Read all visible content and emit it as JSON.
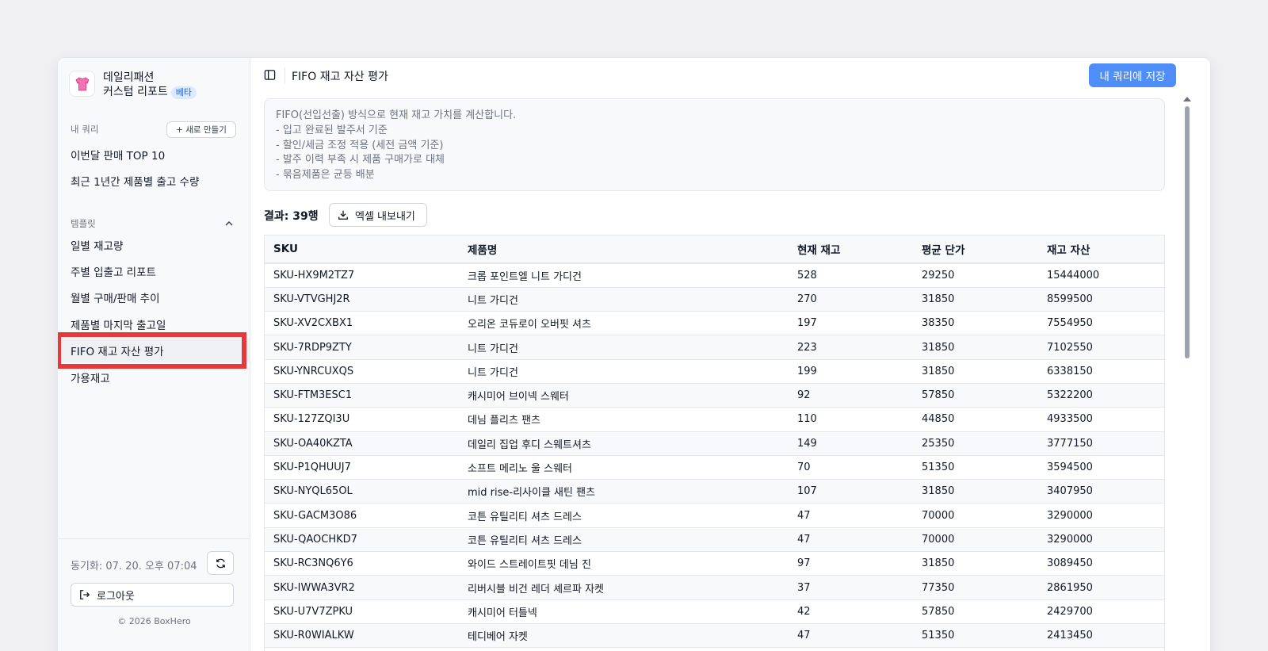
{
  "brand": {
    "name_line1": "데일리패션",
    "name_line2": "커스텀 리포트",
    "badge": "베타"
  },
  "sidebar": {
    "my_queries_label": "내 쿼리",
    "new_button": "+ 새로 만들기",
    "my_queries": [
      "이번달 판매 TOP 10",
      "최근 1년간 제품별 출고 수량"
    ],
    "templates_label": "템플릿",
    "templates": [
      "일별 재고량",
      "주별 입출고 리포트",
      "월별 구매/판매 추이",
      "제품별 마지막 출고일",
      "FIFO 재고 자산 평가",
      "가용재고"
    ],
    "active_template": "FIFO 재고 자산 평가",
    "sync_text": "동기화: 07. 20. 오후 07:04",
    "logout": "로그아웃",
    "copyright": "© 2026 BoxHero"
  },
  "header": {
    "title": "FIFO 재고 자산 평가",
    "save_button": "내 쿼리에 저장"
  },
  "description": [
    "FIFO(선입선출) 방식으로 현재 재고 가치를 계산합니다.",
    "- 입고 완료된 발주서 기준",
    "- 할인/세금 조정 적용 (세전 금액 기준)",
    "- 발주 이력 부족 시 제품 구매가로 대체",
    "- 묶음제품은 균등 배분"
  ],
  "result": {
    "label": "결과: 39행",
    "export_button": "엑셀 내보내기"
  },
  "table": {
    "columns": [
      "SKU",
      "제품명",
      "현재 재고",
      "평균 단가",
      "재고 자산"
    ],
    "rows": [
      [
        "SKU-HX9M2TZ7",
        "크롭 포인트엘 니트 가디건",
        "528",
        "29250",
        "15444000"
      ],
      [
        "SKU-VTVGHJ2R",
        "니트 가디건",
        "270",
        "31850",
        "8599500"
      ],
      [
        "SKU-XV2CXBX1",
        "오리온 코듀로이 오버핏 셔츠",
        "197",
        "38350",
        "7554950"
      ],
      [
        "SKU-7RDP9ZTY",
        "니트 가디건",
        "223",
        "31850",
        "7102550"
      ],
      [
        "SKU-YNRCUXQS",
        "니트 가디건",
        "199",
        "31850",
        "6338150"
      ],
      [
        "SKU-FTM3ESC1",
        "캐시미어 브이넥 스웨터",
        "92",
        "57850",
        "5322200"
      ],
      [
        "SKU-127ZQI3U",
        "데님 플리츠 팬츠",
        "110",
        "44850",
        "4933500"
      ],
      [
        "SKU-OA40KZTA",
        "데일리 집업 후디 스웨트셔츠",
        "149",
        "25350",
        "3777150"
      ],
      [
        "SKU-P1QHUUJ7",
        "소프트 메리노 울 스웨터",
        "70",
        "51350",
        "3594500"
      ],
      [
        "SKU-NYQL65OL",
        "mid rise-리사이클 새틴 팬츠",
        "107",
        "31850",
        "3407950"
      ],
      [
        "SKU-GACM3O86",
        "코튼 유틸리티 셔츠 드레스",
        "47",
        "70000",
        "3290000"
      ],
      [
        "SKU-QAOCHKD7",
        "코튼 유틸리티 셔츠 드레스",
        "47",
        "70000",
        "3290000"
      ],
      [
        "SKU-RC3NQ6Y6",
        "와이드 스트레이트핏 데님 진",
        "97",
        "31850",
        "3089450"
      ],
      [
        "SKU-IWWA3VR2",
        "리버시블 비건 레더 셰르파 자켓",
        "37",
        "77350",
        "2861950"
      ],
      [
        "SKU-U7V7ZPKU",
        "캐시미어 터틀넥",
        "42",
        "57850",
        "2429700"
      ],
      [
        "SKU-R0WIALKW",
        "테디베어 자켓",
        "47",
        "51350",
        "2413450"
      ]
    ]
  },
  "colors": {
    "accent": "#4f8df7",
    "highlight": "#e5393b",
    "badge_bg": "#dbeafe"
  }
}
